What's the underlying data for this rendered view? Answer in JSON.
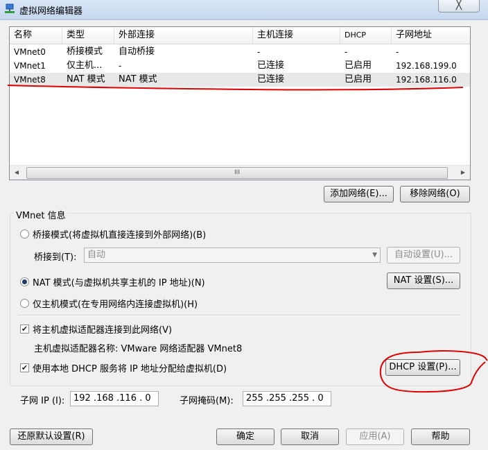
{
  "window": {
    "title": "虚拟网络编辑器",
    "close": "╳"
  },
  "table": {
    "headers": [
      "名称",
      "类型",
      "外部连接",
      "主机连接",
      "DHCP",
      "子网地址"
    ],
    "rows": [
      [
        "VMnet0",
        "桥接模式",
        "自动桥接",
        "-",
        "-",
        "-"
      ],
      [
        "VMnet1",
        "仅主机...",
        "-",
        "已连接",
        "已启用",
        "192.168.199.0"
      ],
      [
        "VMnet8",
        "NAT 模式",
        "NAT 模式",
        "已连接",
        "已启用",
        "192.168.116.0"
      ]
    ],
    "selected_row": 2,
    "scroll_thumb": "III"
  },
  "buttons": {
    "add_network": "添加网络(E)...",
    "remove_network": "移除网络(O)",
    "auto_settings": "自动设置(U)...",
    "nat_settings": "NAT 设置(S)...",
    "dhcp_settings": "DHCP 设置(P)...",
    "restore_defaults": "还原默认设置(R)",
    "ok": "确定",
    "cancel": "取消",
    "apply": "应用(A)",
    "help": "帮助"
  },
  "vmnet_info": {
    "group_label": "VMnet 信息",
    "bridged_radio": "桥接模式(将虚拟机直接连接到外部网络)(B)",
    "bridged_to_label": "桥接到(T):",
    "bridged_to_value": "自动",
    "nat_radio": "NAT 模式(与虚拟机共享主机的 IP 地址)(N)",
    "hostonly_radio": "仅主机模式(在专用网络内连接虚拟机)(H)",
    "selected_mode": "nat",
    "connect_adapter_check": "将主机虚拟适配器连接到此网络(V)",
    "connect_adapter_checked": true,
    "adapter_name": "主机虚拟适配器名称: VMware 网络适配器 VMnet8",
    "dhcp_check": "使用本地 DHCP 服务将 IP 地址分配给虚拟机(D)",
    "dhcp_checked": true,
    "subnet_ip_label": "子网 IP (I):",
    "subnet_ip_value": "192 .168 .116 .  0",
    "subnet_mask_label": "子网掩码(M):",
    "subnet_mask_value": "255 .255 .255 .  0"
  },
  "annotation_color": "#e00000"
}
